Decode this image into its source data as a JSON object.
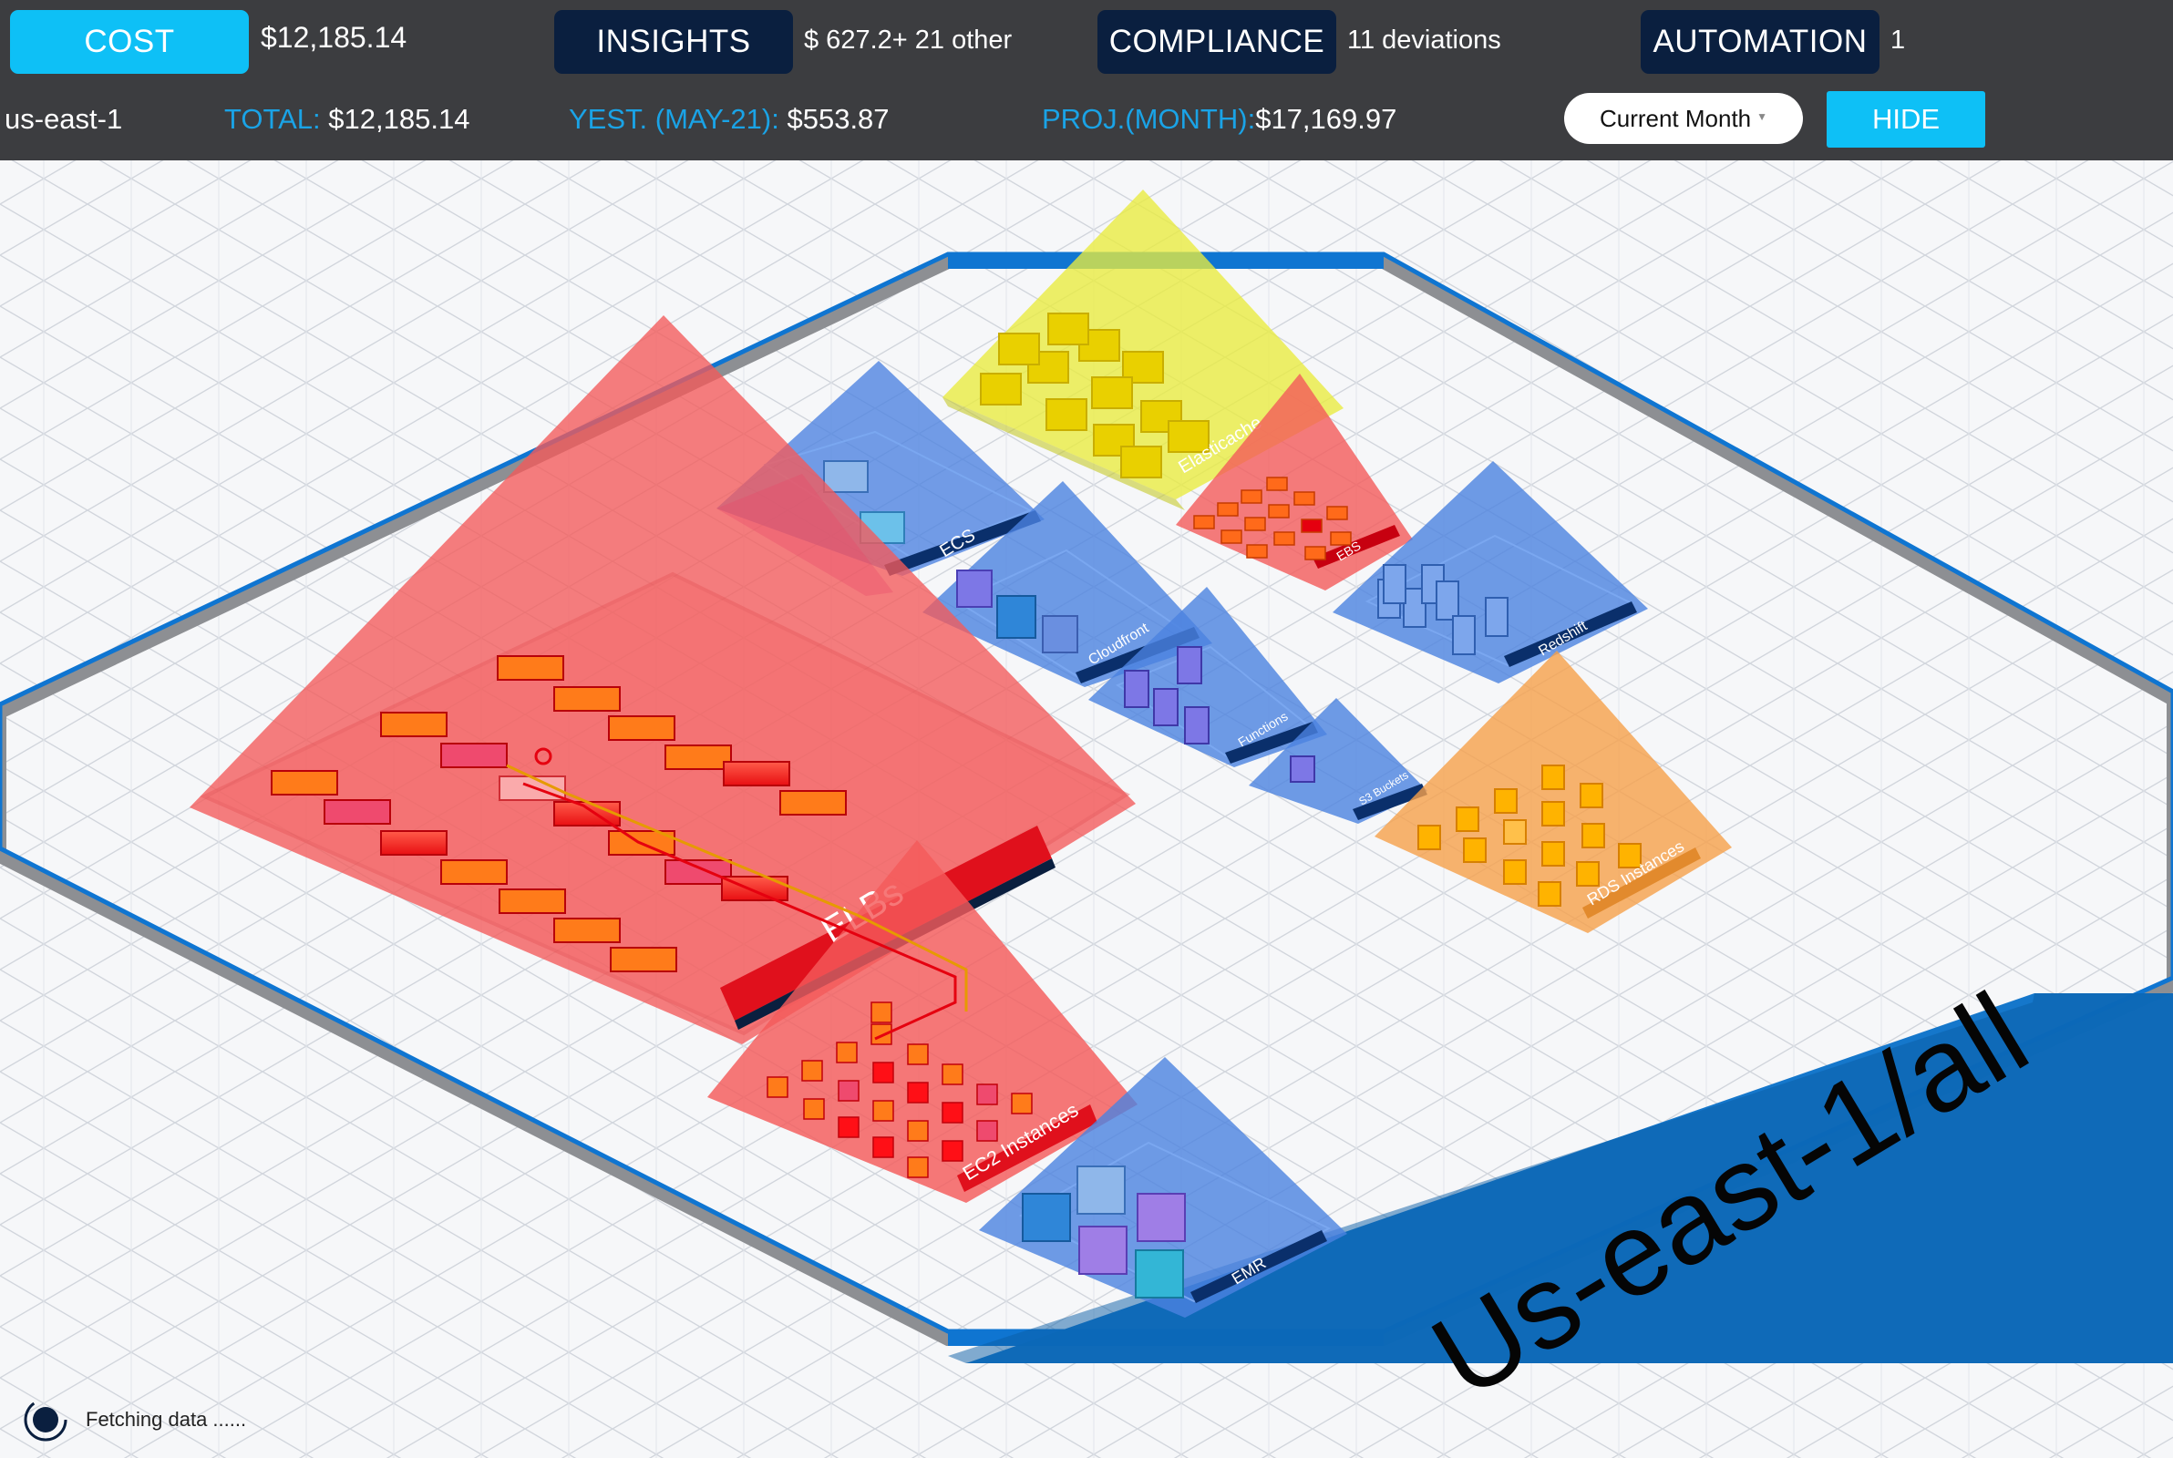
{
  "header": {
    "tabs": [
      {
        "label": "COST",
        "value": "$12,185.14"
      },
      {
        "label": "INSIGHTS",
        "value": "$ 627.2+ 21 other"
      },
      {
        "label": "COMPLIANCE",
        "value": "11 deviations"
      },
      {
        "label": "AUTOMATION",
        "value": "1"
      }
    ],
    "region": "us-east-1",
    "total_label": "TOTAL:",
    "total_value": "$12,185.14",
    "yest_label": "YEST. (MAY-21):",
    "yest_value": "$553.87",
    "proj_label": "PROJ.(MONTH):",
    "proj_value": "$17,169.97",
    "period_select": "Current Month",
    "hide_label": "HIDE"
  },
  "scene": {
    "region_label": "Us-east-1/all",
    "groups": [
      {
        "id": "elbs",
        "label": "ELBs"
      },
      {
        "id": "ec2",
        "label": "EC2 Instances"
      },
      {
        "id": "emr",
        "label": "EMR"
      },
      {
        "id": "ecs",
        "label": "ECS"
      },
      {
        "id": "cloudfront",
        "label": "Cloudfront"
      },
      {
        "id": "functions",
        "label": "Functions"
      },
      {
        "id": "s3",
        "label": "S3 Buckets"
      },
      {
        "id": "elasticache",
        "label": "Elasticache"
      },
      {
        "id": "ebs",
        "label": "EBS"
      },
      {
        "id": "redshift",
        "label": "Redshift"
      },
      {
        "id": "rds",
        "label": "RDS Instances"
      }
    ]
  },
  "status": {
    "text": "Fetching data ......"
  },
  "colors": {
    "accent": "#0ec0f6",
    "dark_button": "#0a1f3f",
    "label_blue": "#1aa3e6",
    "red_zone": "#f45a5a",
    "blue_zone": "#4b82e0",
    "yellow_zone": "#e8ec4a",
    "orange_zone": "#f6a04a",
    "region_banner": "#0d73c9"
  }
}
